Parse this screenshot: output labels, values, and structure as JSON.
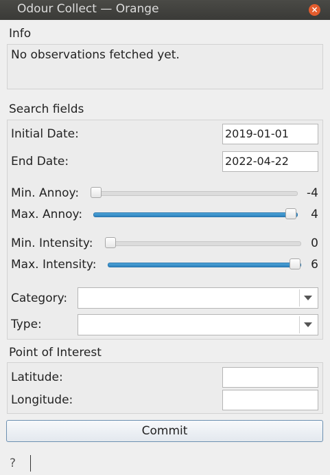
{
  "window": {
    "title": "Odour Collect — Orange",
    "close_label": "×"
  },
  "info": {
    "label": "Info",
    "text": "No observations fetched yet."
  },
  "search": {
    "label": "Search fields",
    "initial_date_label": "Initial Date:",
    "initial_date_value": "2019-01-01",
    "end_date_label": "End Date:",
    "end_date_value": "2022-04-22",
    "min_annoy": {
      "label": "Min. Annoy:",
      "value": "-4",
      "fraction": 0
    },
    "max_annoy": {
      "label": "Max. Annoy:",
      "value": "4",
      "fraction": 1
    },
    "min_intensity": {
      "label": "Min. Intensity:",
      "value": "0",
      "fraction": 0
    },
    "max_intensity": {
      "label": "Max. Intensity:",
      "value": "6",
      "fraction": 1
    },
    "category_label": "Category:",
    "category_value": "",
    "type_label": "Type:",
    "type_value": ""
  },
  "poi": {
    "label": "Point of Interest",
    "latitude_label": "Latitude:",
    "latitude_value": "",
    "longitude_label": "Longitude:",
    "longitude_value": ""
  },
  "actions": {
    "commit_label": "Commit"
  },
  "statusbar": {
    "help_icon": "?"
  }
}
